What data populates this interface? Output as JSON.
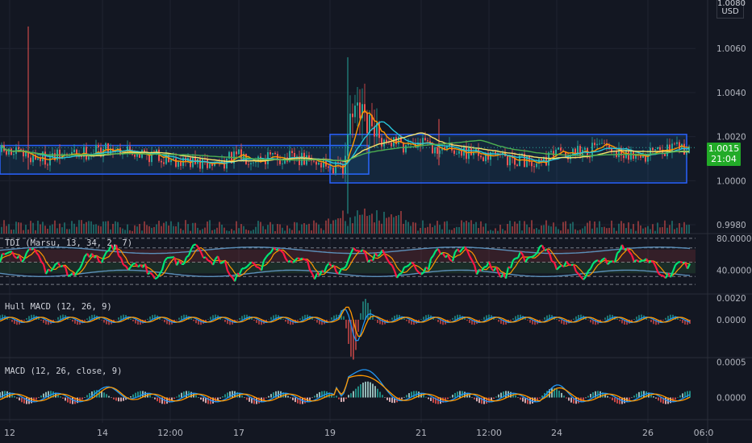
{
  "header": {
    "currency_top": "1.0080",
    "currency_unit": "USD"
  },
  "last_price": {
    "value": "1.0015",
    "countdown": "21:04",
    "color": "#22ab28"
  },
  "colors": {
    "up": "#26a69a",
    "down": "#ef5350",
    "bg": "#131722",
    "grid": "#1f2330",
    "channel": "#2962ff",
    "ma_yellow": "#f7e36b",
    "ma_orange": "#ff9800",
    "ma_teal": "#26c6da",
    "ma_green": "#4caf50",
    "text": "#b2b5be",
    "tdi_green": "#00e676",
    "tdi_red": "#ff1744",
    "tdi_band": "#5b8fb9"
  },
  "chart_data": [
    {
      "type": "candlestick",
      "title": "",
      "ylim": [
        0.9976,
        1.0082
      ],
      "y_ticks": [
        "1.0060",
        "1.0040",
        "1.0020",
        "1.0000",
        "0.9980"
      ],
      "x_ticks": [
        "12",
        "14",
        "12:00",
        "17",
        "19",
        "21",
        "12:00",
        "24",
        "26",
        "06:0"
      ],
      "channels": [
        {
          "x_start": "12",
          "x_end": "19",
          "y_top": 1.0016,
          "y_bottom": 1.0003
        },
        {
          "x_start": "19",
          "x_end": "26",
          "y_top": 1.0021,
          "y_bottom": 0.9999
        }
      ],
      "last": 1.0015,
      "trend_anchors": [
        {
          "x": "12",
          "y": 1.0013
        },
        {
          "x": "14",
          "y": 1.0012
        },
        {
          "x": "12:00",
          "y": 1.0009
        },
        {
          "x": "17",
          "y": 1.0011
        },
        {
          "x": "19",
          "y": 1.0006
        },
        {
          "x": "19",
          "y": 1.003
        },
        {
          "x": "21",
          "y": 1.0016
        },
        {
          "x": "12:00",
          "y": 1.0011
        },
        {
          "x": "24",
          "y": 1.001
        },
        {
          "x": "26",
          "y": 1.0014
        },
        {
          "x": "06:0",
          "y": 1.0015
        }
      ],
      "spikes": [
        {
          "x": "12",
          "high": 1.007,
          "low": 1.0005
        },
        {
          "x": "19",
          "high": 1.0056,
          "low": 0.9985
        },
        {
          "x": "21",
          "high": 1.0028,
          "low": 1.0007
        }
      ]
    },
    {
      "type": "line",
      "name": "TDI (Marsu, 13, 34, 2, 7)",
      "ylim": [
        10,
        85
      ],
      "y_ticks": [
        "80.0000",
        "40.0000"
      ],
      "levels": [
        68,
        50,
        32
      ]
    },
    {
      "type": "bar",
      "name": "Hull MACD (12, 26, 9)",
      "ylim": [
        -0.0035,
        0.0023
      ],
      "y_ticks": [
        "0.0020",
        "0.0000"
      ]
    },
    {
      "type": "bar",
      "name": "MACD (12, 26, close, 9)",
      "ylim": [
        -0.0003,
        0.00055
      ],
      "y_ticks": [
        "0.0005",
        "0.0000"
      ]
    }
  ],
  "indicators": {
    "tdi": "TDI (Marsu, 13, 34, 2, 7)",
    "hull": "Hull MACD (12, 26, 9)",
    "macd": "MACD (12, 26, close, 9)"
  }
}
